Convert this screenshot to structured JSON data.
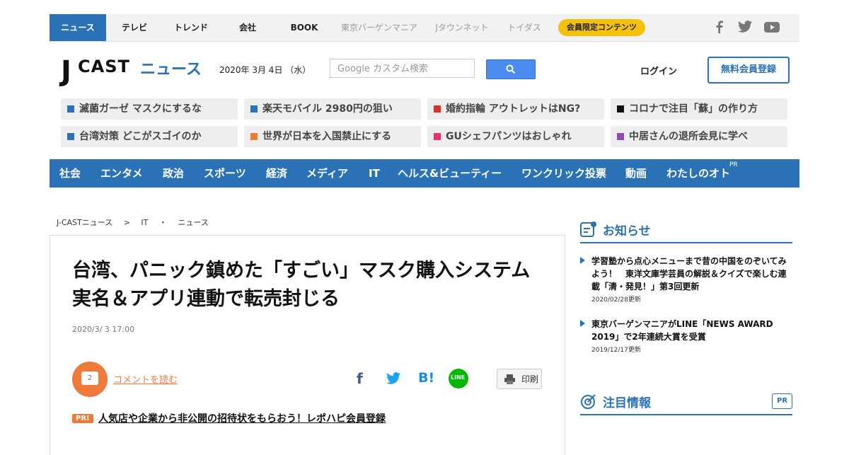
{
  "top_nav": {
    "items": [
      "ニュース",
      "テレビ",
      "トレンド",
      "会社",
      "BOOK",
      "東京バーゲンマニア",
      "Jタウンネット",
      "トイダス"
    ],
    "member_badge": "会員限定コンテンツ",
    "social": [
      "facebook-icon",
      "twitter-icon",
      "youtube-icon"
    ]
  },
  "header": {
    "logo_j": "J",
    "logo_cast": "CAST",
    "logo_news": "ニュース",
    "date": "2020年 3月 4日 （水）",
    "search_placeholder": "Google カスタム検索",
    "login": "ログイン",
    "register": "無料会員登録"
  },
  "trend_tags": [
    {
      "label": "滅菌ガーゼ マスクにするな",
      "color": "#2a72b5"
    },
    {
      "label": "楽天モバイル 2980円の狙い",
      "color": "#2a72b5"
    },
    {
      "label": "婚約指輪 アウトレットはNG?",
      "color": "#e0302a"
    },
    {
      "label": "コロナで注目「蘇」の作り方",
      "color": "#111111"
    },
    {
      "label": "台湾対策 どこがスゴイのか",
      "color": "#2a72b5"
    },
    {
      "label": "世界が日本を入国禁止にする",
      "color": "#f07a3a"
    },
    {
      "label": "GUシェフパンツはおしゃれ",
      "color": "#e8306a"
    },
    {
      "label": "中居さんの退所会見に学べ",
      "color": "#8e4ab0"
    }
  ],
  "category_nav": {
    "items": [
      "社会",
      "エンタメ",
      "政治",
      "スポーツ",
      "経済",
      "メディア",
      "IT",
      "ヘルス&ビューティー",
      "ワンクリック投票",
      "動画",
      "わたしのオト"
    ],
    "pr": "PR"
  },
  "breadcrumb": [
    "J-CASTニュース",
    ">",
    "IT",
    "・",
    "ニュース"
  ],
  "article": {
    "title": "台湾、パニック鎮めた「すごい」マスク購入システム　実名＆アプリ連動で転売封じる",
    "date": "2020/3/ 3 17:00",
    "comment_count": "2",
    "comment_link": "コメントを読む",
    "share": {
      "facebook": "f",
      "hatena": "B!",
      "line": "LINE"
    },
    "print": "印刷",
    "pr_badge": "PR!",
    "pr_link": "人気店や企業から非公開の招待状をもらおう！レポハピ会員登録"
  },
  "sidebar": {
    "notice_title": "お知らせ",
    "notices": [
      {
        "text": "学習塾から点心メニューまで昔の中国をのぞいてみよう！　東洋文庫学芸員の解説＆クイズで楽しむ連載「清・発見！」第3回更新",
        "date": "2020/02/28更新"
      },
      {
        "text": "東京バーゲンマニアがLINE「NEWS AWARD 2019」で2年連続大賞を受賞",
        "date": "2019/12/17更新"
      }
    ],
    "featured_title": "注目情報",
    "featured_pr": "PR"
  }
}
